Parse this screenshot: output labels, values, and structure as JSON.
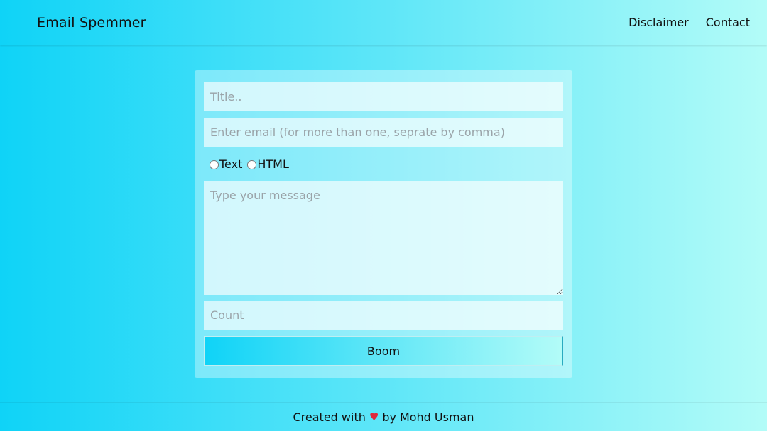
{
  "navbar": {
    "brand": "Email Spemmer",
    "links": [
      "Disclaimer",
      "Contact"
    ]
  },
  "form": {
    "title_placeholder": "Title..",
    "email_placeholder": "Enter email (for more than one, seprate by comma)",
    "format_options": [
      "Text",
      "HTML"
    ],
    "message_placeholder": "Type your message",
    "count_placeholder": "Count",
    "submit_label": "Boom"
  },
  "footer": {
    "prefix": "Created with",
    "heart_icon": "heart-icon",
    "by": "by",
    "author": "Mohd Usman"
  },
  "colors": {
    "gradient_start": "#0fd3f7",
    "gradient_end": "#b3fcf8",
    "heart": "#e0283a"
  }
}
